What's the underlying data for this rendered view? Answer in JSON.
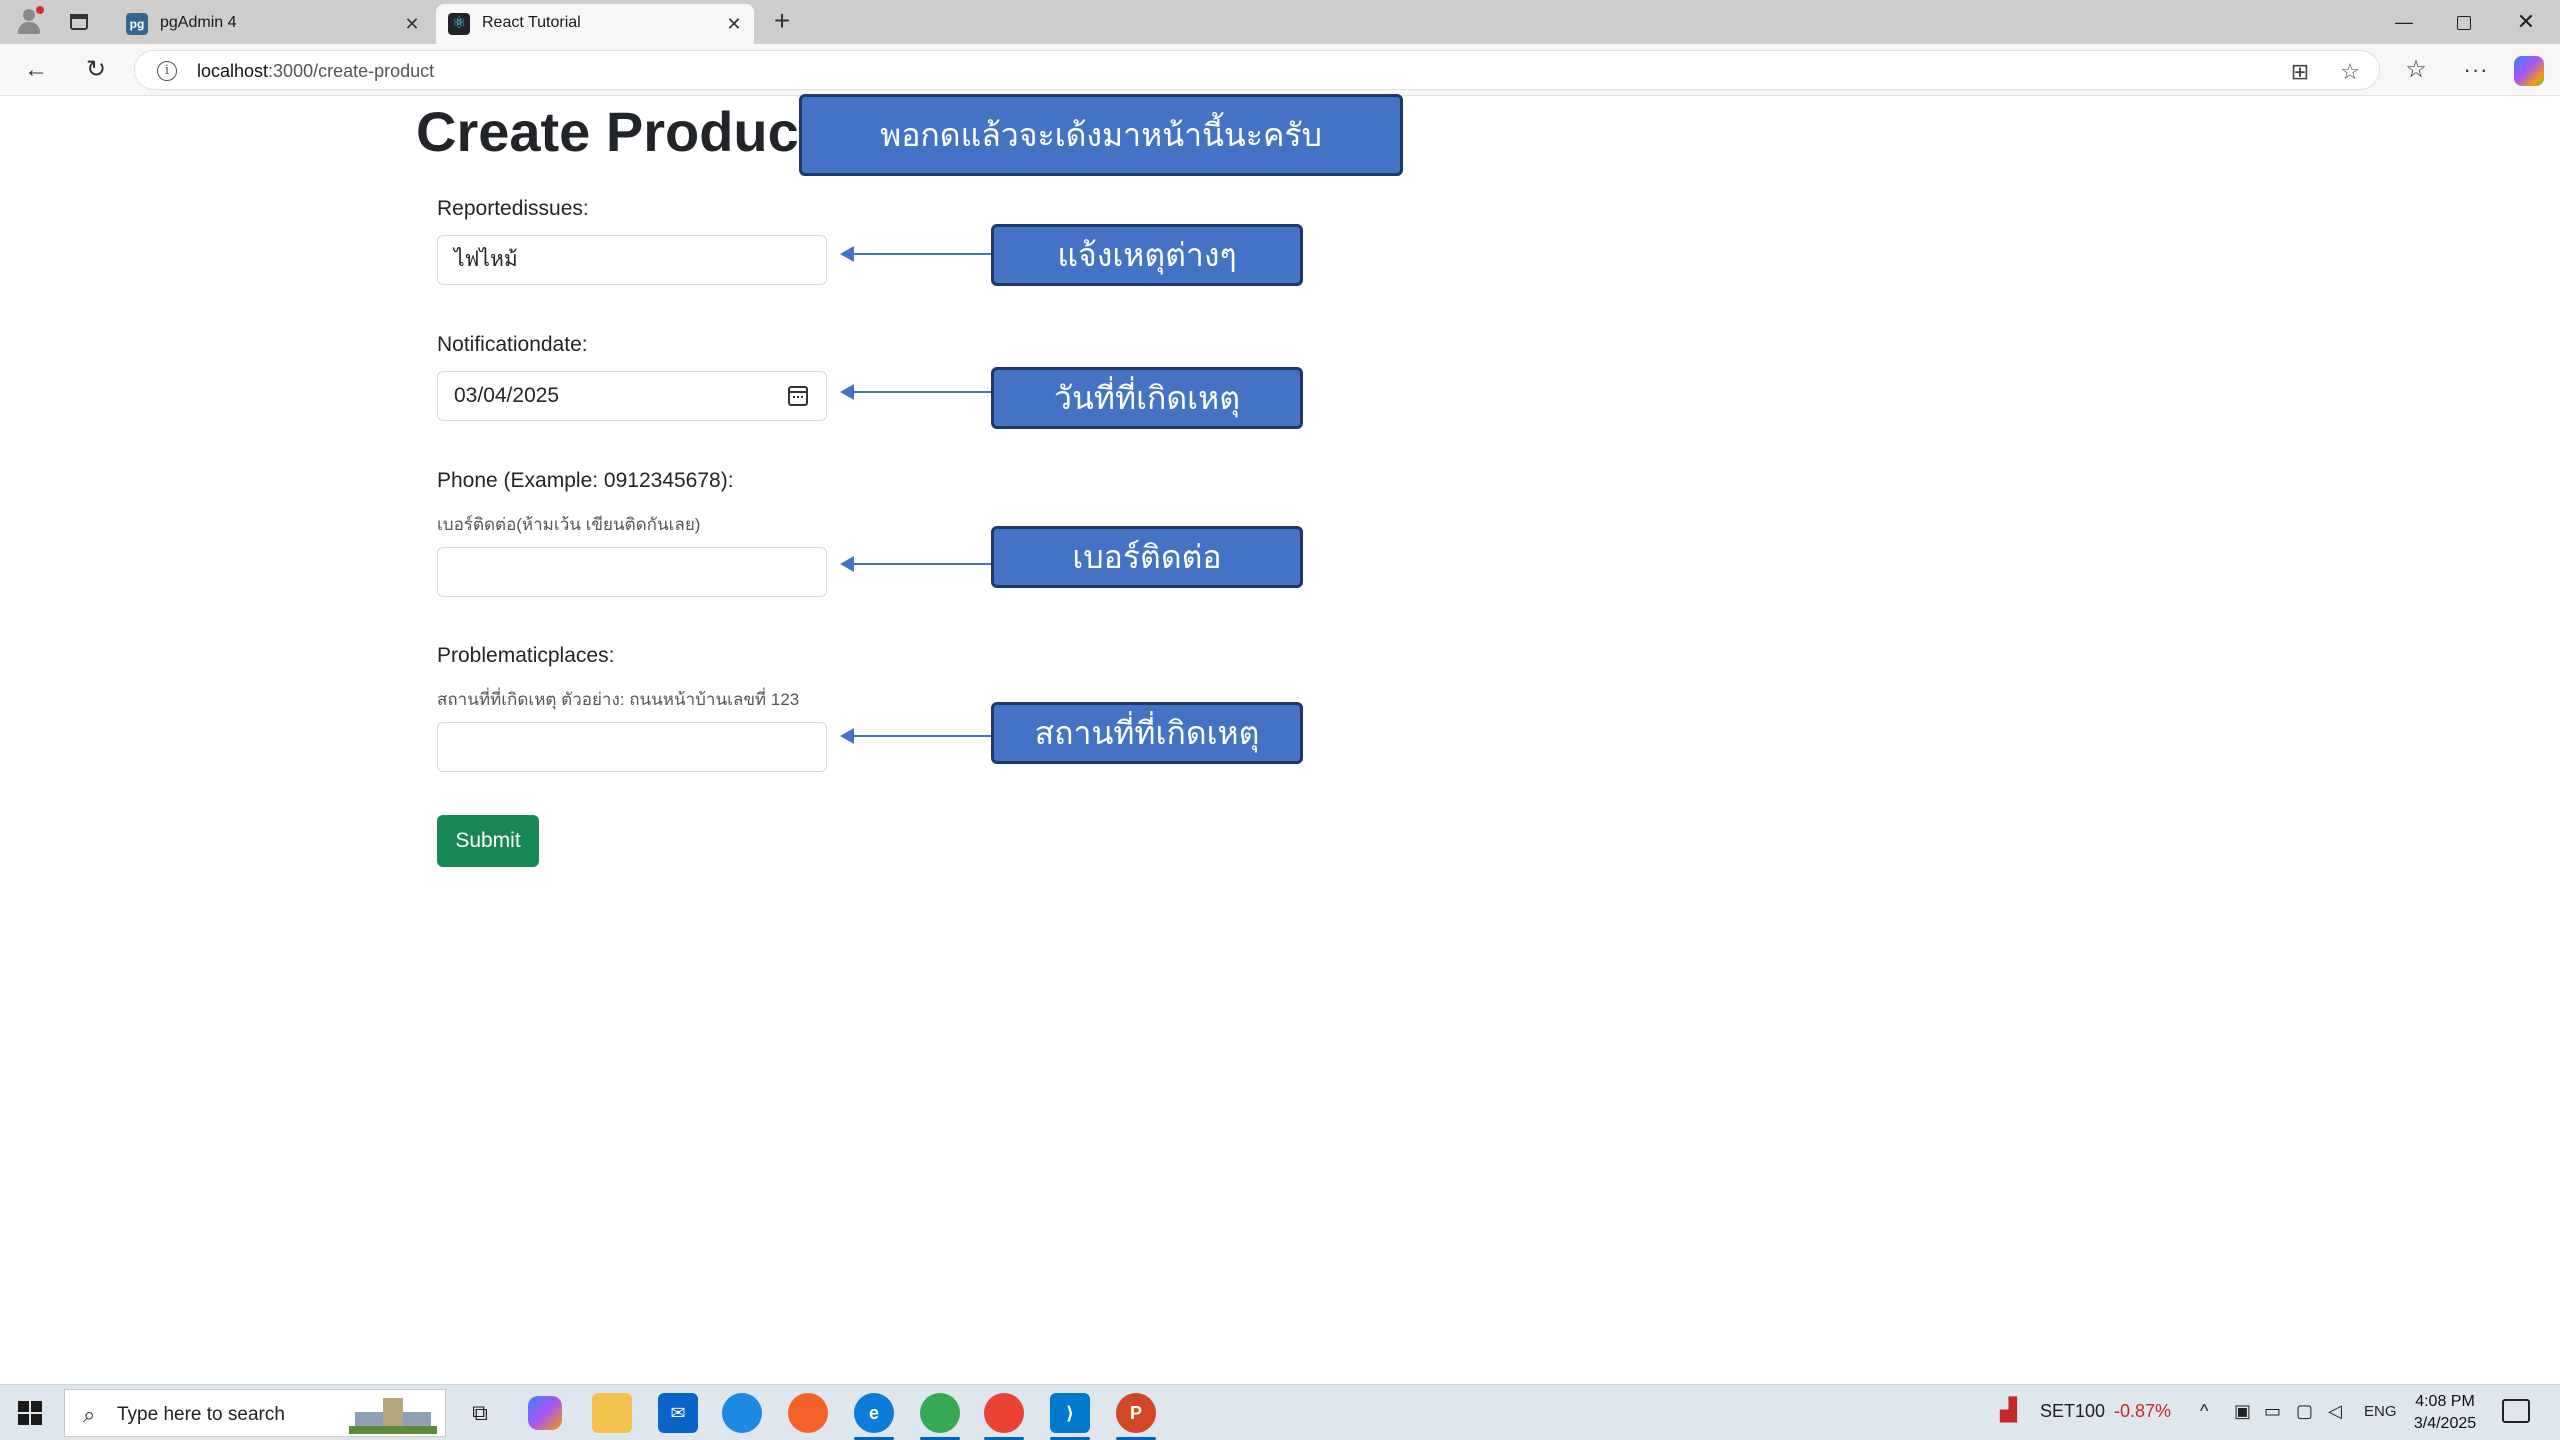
{
  "browser": {
    "tabs": [
      {
        "title": "pgAdmin 4",
        "favicon": "pgadmin-icon",
        "active": false
      },
      {
        "title": "React Tutorial",
        "favicon": "react-icon",
        "active": true
      }
    ],
    "address": {
      "host": "localhost",
      "path": ":3000/create-product"
    }
  },
  "page": {
    "title": "Create Product",
    "fields": {
      "reported_issues": {
        "label": "Reportedissues:",
        "value": "ไฟไหม้"
      },
      "notification_date": {
        "label": "Notificationdate:",
        "value": "03/04/2025"
      },
      "phone": {
        "label": "Phone (Example: 0912345678):",
        "help": "เบอร์ติดต่อ(ห้ามเว้น เขียนติดกันเลย)",
        "value": ""
      },
      "problematic_places": {
        "label": "Problematicplaces:",
        "help": "สถานที่ที่เกิดเหตุ ตัวอย่าง: ถนนหน้าบ้านเลขที่ 123",
        "value": ""
      }
    },
    "submit_label": "Submit"
  },
  "annotations": {
    "main": "พอกดแล้วจะเด้งมาหน้านี้นะครับ",
    "reported_issues": "แจ้งเหตุต่างๆ",
    "notification_date": "วันที่ที่เกิดเหตุ",
    "phone": "เบอร์ติดต่อ",
    "problematic_places": "สถานที่ที่เกิดเหตุ",
    "color": "#4472c4"
  },
  "taskbar": {
    "search_placeholder": "Type here to search",
    "stock": {
      "name": "SET100",
      "change": "-0.87%"
    },
    "language": "ENG",
    "time": "4:08 PM",
    "date": "3/4/2025"
  }
}
